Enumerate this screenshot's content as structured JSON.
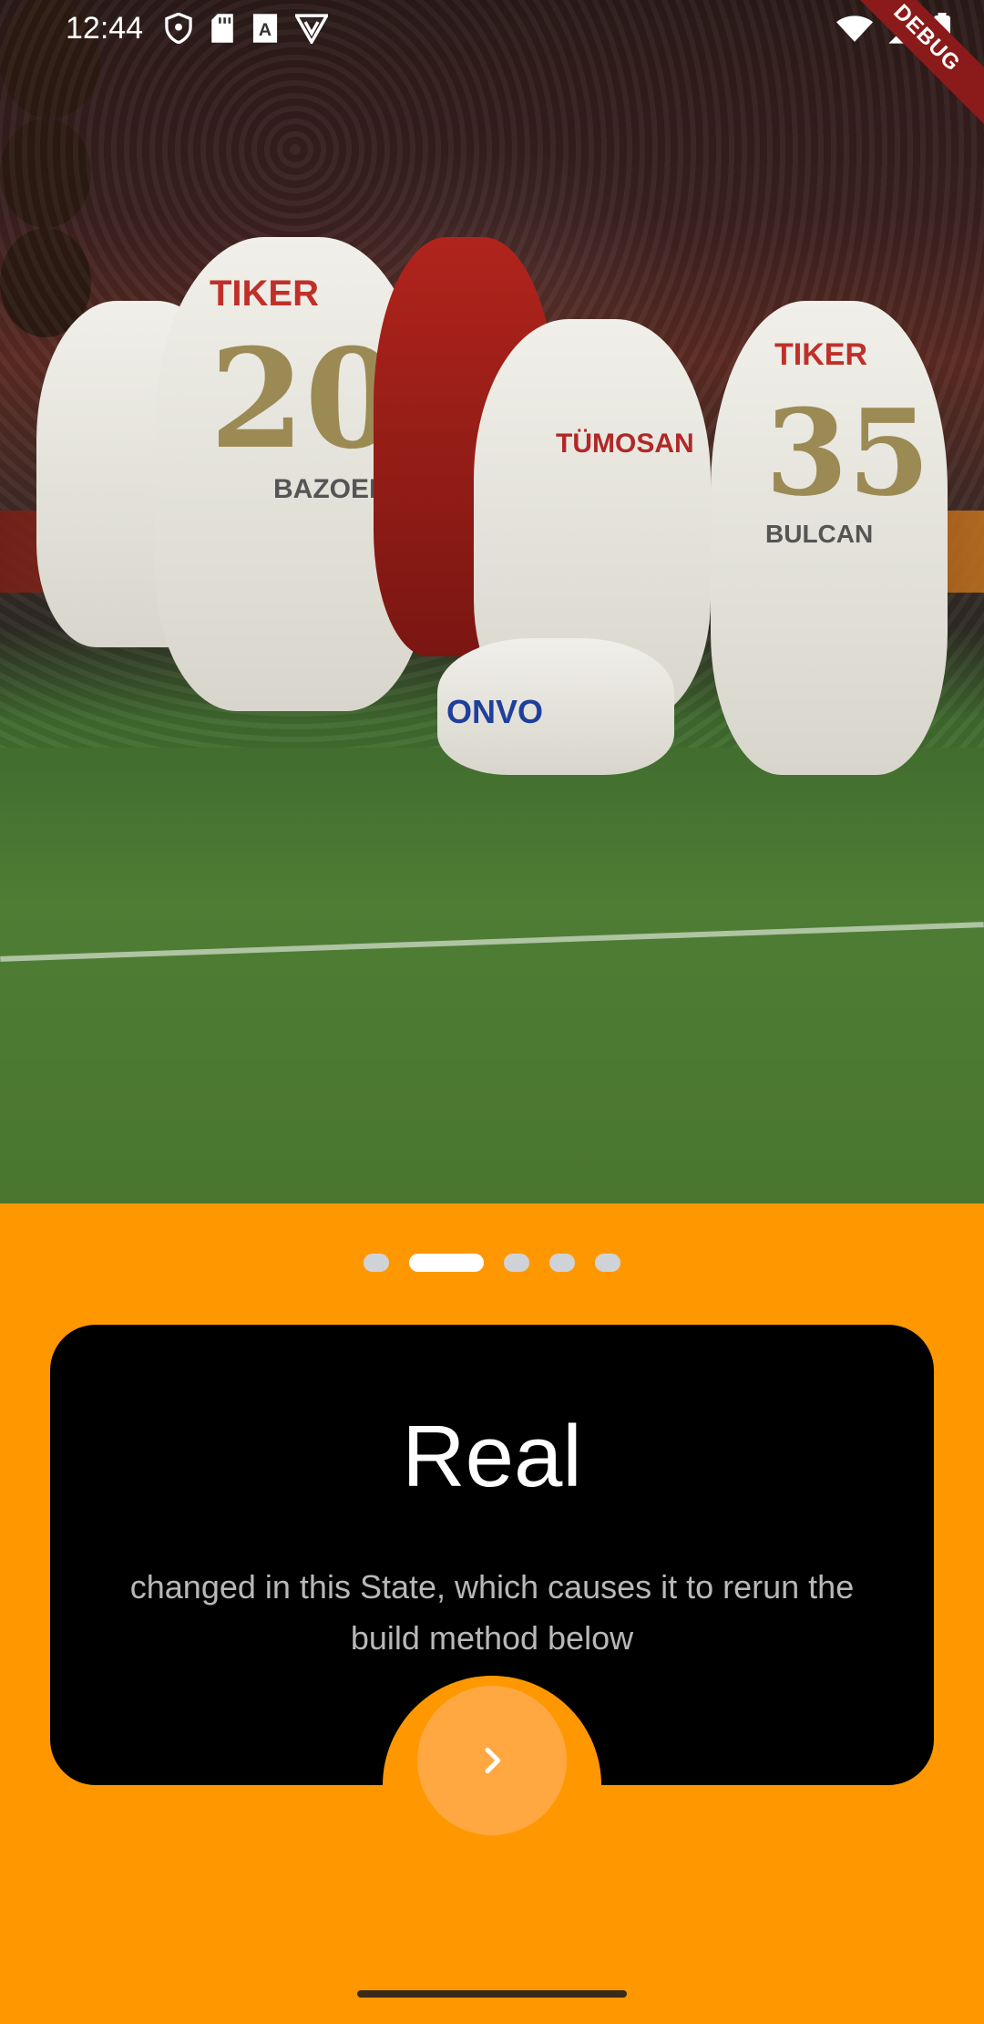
{
  "status_bar": {
    "time": "12:44",
    "left_icons": [
      "shield-icon",
      "sd-card-icon",
      "a-icon",
      "vpn-icon"
    ],
    "right_icons": [
      "wifi-icon",
      "signal-icon",
      "battery-icon"
    ],
    "debug_label": "DEBUG"
  },
  "onboarding": {
    "page_count": 5,
    "active_index": 1,
    "title": "Real",
    "description": "changed in this State, which causes it to rerun the build method below",
    "next_icon": "chevron-right-icon"
  },
  "colors": {
    "background": "#FF9800",
    "card": "#000000",
    "next_button": "#FFA842",
    "dot_active": "#FFFFFF",
    "dot_inactive": "#CFD3D8"
  },
  "photo": {
    "jersey_numbers": [
      "20",
      "35"
    ],
    "sponsor_texts": [
      "TIKER",
      "TÜMOSAN",
      "TIKER",
      "ONVO"
    ],
    "player_names": [
      "BAZOER",
      "BULCAN"
    ]
  }
}
